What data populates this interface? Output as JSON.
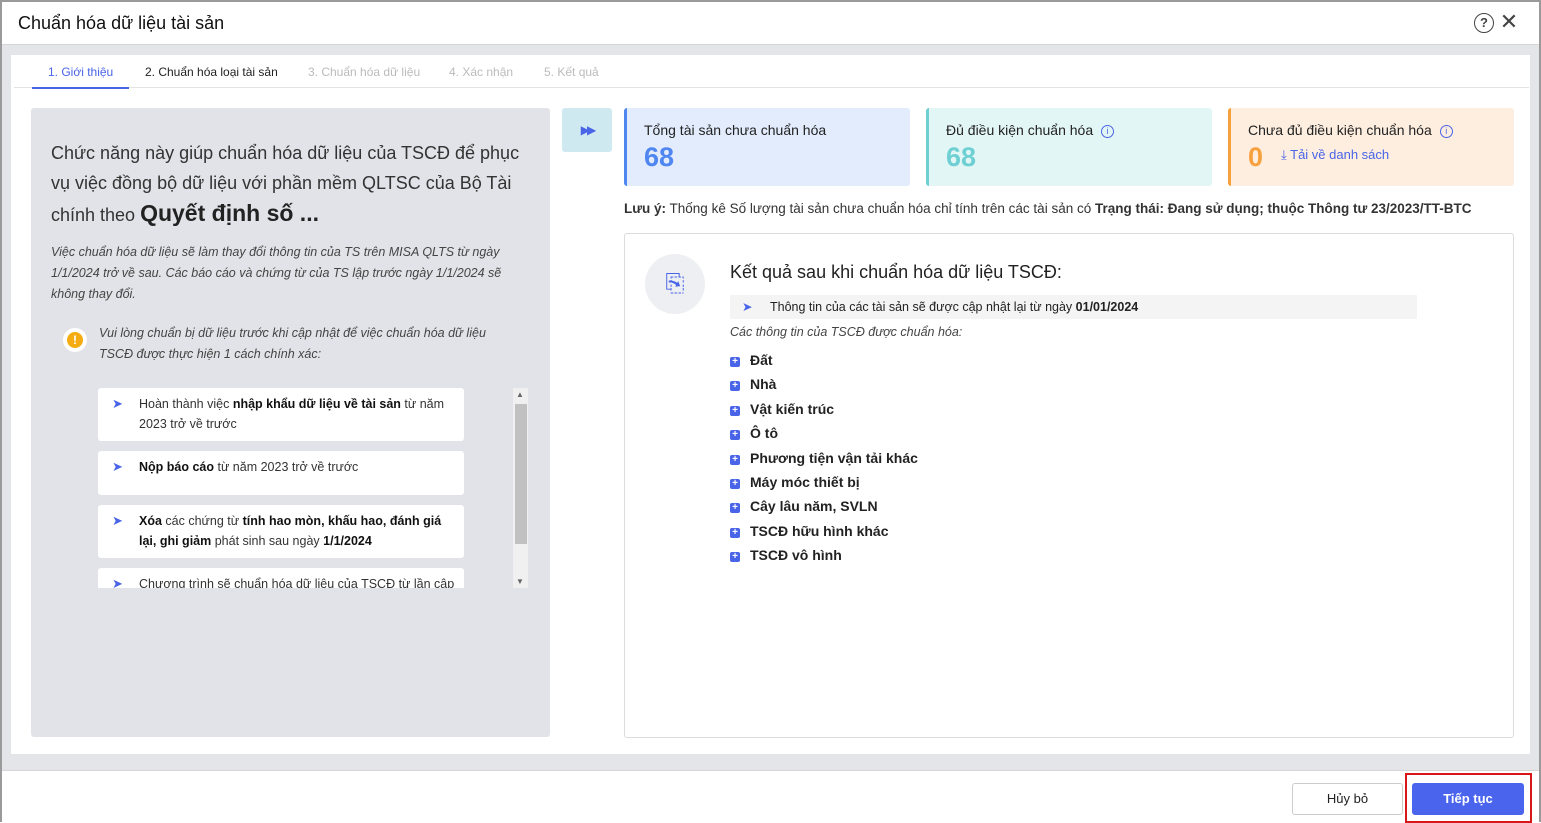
{
  "window": {
    "title": "Chuẩn hóa dữ liệu tài sản",
    "help_icon": "help-circle-icon",
    "close_icon": "close-icon"
  },
  "tabs": [
    "1. Giới thiệu",
    "2. Chuẩn hóa loại tài sản",
    "3. Chuẩn hóa dữ liệu",
    "4. Xác nhận",
    "5. Kết quả"
  ],
  "intro": {
    "lead": "Chức năng này giúp chuẩn hóa dữ liệu của TSCĐ để phục vụ việc đồng bộ dữ liệu với phần mềm QLTSC của Bộ Tài chính theo ",
    "lead_bold": "Quyết định số ...",
    "note": "Việc chuẩn hóa dữ liệu sẽ làm thay đổi thông tin của TS trên MISA QLTS từ ngày 1/1/2024 trở về sau. Các báo cáo và chứng từ của TS lập trước ngày 1/1/2024 sẽ không thay đổi.",
    "warning": "Vui lòng chuẩn bị dữ liệu trước khi cập nhật để việc chuẩn hóa dữ liệu TSCĐ được thực hiện 1 cách chính xác:",
    "items": [
      {
        "a": "Hoàn thành việc ",
        "b": "nhập khẩu dữ liệu về tài sản",
        "c": " từ năm 2023 trở về trước",
        "d": "",
        "e": "",
        "f": "",
        "g": ""
      },
      {
        "a": "",
        "b": "Nộp báo cáo",
        "c": " từ năm 2023 trở về trước",
        "d": "",
        "e": "",
        "f": "",
        "g": ""
      },
      {
        "a": "",
        "b": "Xóa",
        "c": " các chứng từ ",
        "d": "tính hao mòn, khấu hao, đánh giá lại, ghi giảm",
        "e": " phát sinh sau ngày ",
        "f": "1/1/2024",
        "g": ""
      },
      {
        "a": "Chương trình sẽ chuẩn hóa dữ liệu của TSCĐ từ lần cập",
        "b": "",
        "c": "",
        "d": "",
        "e": "",
        "f": "",
        "g": ""
      }
    ]
  },
  "cards": [
    {
      "label": "Tổng tài sản chưa chuẩn hóa",
      "value": "68",
      "color": "#4f86f0"
    },
    {
      "label": "Đủ điều kiện chuẩn hóa",
      "value": "68",
      "color": "#6fd0d3"
    },
    {
      "label": "Chưa đủ điều kiện chuẩn hóa",
      "value": "0",
      "color": "#f7a13e",
      "link": "Tải về danh sách"
    }
  ],
  "note": {
    "label": "Lưu ý:",
    "text": " Thống kê Số lượng tài sản chưa chuẩn hóa chỉ tính trên các tài sản có ",
    "bold": "Trạng thái: Đang sử dụng; thuộc Thông tư 23/2023/TT-BTC"
  },
  "result": {
    "title": "Kết quả sau khi chuẩn hóa dữ liệu TSCĐ:",
    "bar_text": "Thông tin của các tài sản sẽ được cập nhật lại từ ngày ",
    "bar_date": "01/01/2024",
    "subtitle": "Các thông tin của TSCĐ được chuẩn hóa:",
    "categories": [
      "Đất",
      "Nhà",
      "Vật kiến trúc",
      "Ô tô",
      "Phương tiện vận tải khác",
      "Máy móc thiết bị",
      "Cây lâu năm, SVLN",
      "TSCĐ hữu hình khác",
      "TSCĐ vô hình"
    ]
  },
  "footer": {
    "cancel": "Hủy bỏ",
    "next": "Tiếp tục"
  },
  "accent": "#4a64ee"
}
